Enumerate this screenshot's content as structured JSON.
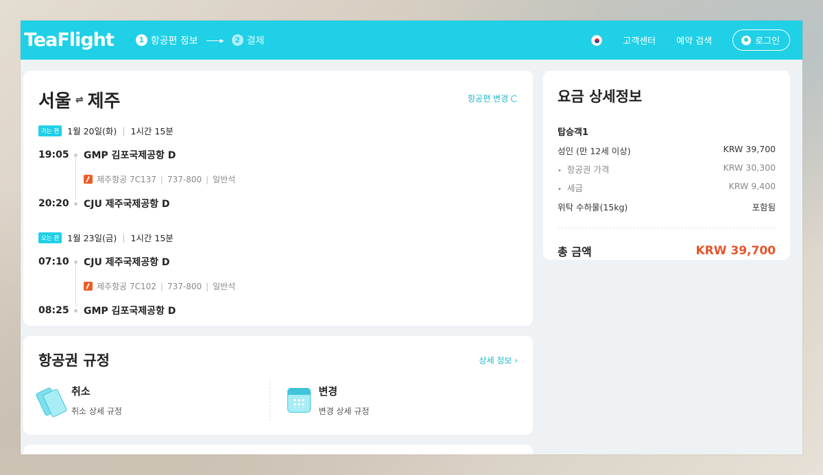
{
  "header": {
    "logo": "TeaFlight",
    "steps": [
      {
        "num": "1",
        "label": "항공편 정보"
      },
      {
        "num": "2",
        "label": "결제"
      }
    ],
    "step_arrow": "------▸",
    "nav": {
      "support": "고객센터",
      "reservation_search": "예약 검색",
      "login": "로그인"
    }
  },
  "flight": {
    "origin": "서울",
    "swap_symbol": "⇌",
    "destination": "제주",
    "change_label": "항공편 변경",
    "outbound": {
      "badge": "가는 편",
      "date": "1월 20일(화)",
      "duration": "1시간 15분",
      "dep_time": "19:05",
      "dep_airport": "GMP 김포국제공항 D",
      "airline": "제주항공 7C137",
      "aircraft": "737-800",
      "cabin": "일반석",
      "arr_time": "20:20",
      "arr_airport": "CJU 제주국제공항 D"
    },
    "inbound": {
      "badge": "오는 편",
      "date": "1월 23일(금)",
      "duration": "1시간 15분",
      "dep_time": "07:10",
      "dep_airport": "CJU 제주국제공항 D",
      "airline": "제주항공 7C102",
      "aircraft": "737-800",
      "cabin": "일반석",
      "arr_time": "08:25",
      "arr_airport": "GMP 김포국제공항 D"
    }
  },
  "rules": {
    "title": "항공권 규정",
    "detail_link": "상세 정보 ›",
    "cancel": {
      "name": "취소",
      "sub": "취소 상세 규정"
    },
    "change": {
      "name": "변경",
      "sub": "변경 상세 규정"
    }
  },
  "fare": {
    "title": "요금 상세정보",
    "passenger": "탑승객1",
    "adult_label": "성인 (만 12세 이상)",
    "adult_value": "KRW 39,700",
    "ticket_label": "항공권 가격",
    "ticket_value": "KRW 30,300",
    "tax_label": "세금",
    "tax_value": "KRW 9,400",
    "baggage_label": "위탁 수하물(15kg)",
    "baggage_value": "포함됨",
    "total_label": "총 금액",
    "total_value": "KRW 39,700"
  },
  "colors": {
    "brand": "#1fd0e6",
    "total": "#e5542a",
    "airline": "#f15a22"
  }
}
